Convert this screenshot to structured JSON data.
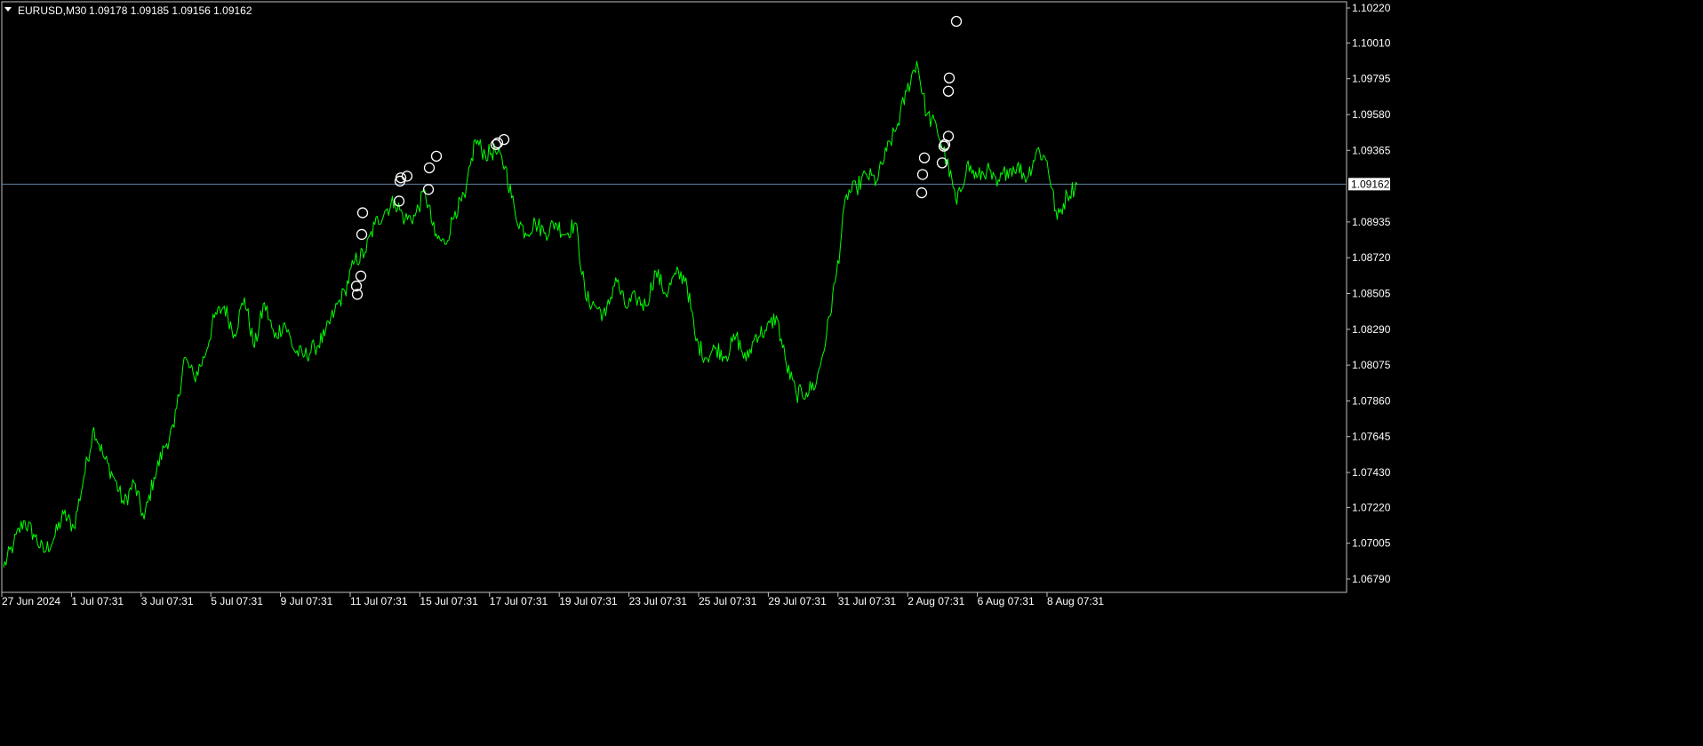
{
  "header": {
    "symbol": "EURUSD,M30",
    "ohlc": "1.09178 1.09185 1.09156 1.09162",
    "dropdown_icon": "triangle-down-icon"
  },
  "colors": {
    "background": "#000000",
    "frame": "#c0c0c0",
    "price_line": "#00ff00",
    "marker": "#ffffff",
    "current_price_line": "#5f7f9f",
    "price_tag_bg": "#ffffff",
    "price_tag_text": "#000000",
    "text": "#ffffff"
  },
  "chart_data": {
    "type": "line",
    "symbol": "EURUSD",
    "timeframe": "M30",
    "y_ticks": [
      "1.10220",
      "1.10010",
      "1.09795",
      "1.09580",
      "1.09365",
      "1.08935",
      "1.08720",
      "1.08505",
      "1.08290",
      "1.08075",
      "1.07860",
      "1.07645",
      "1.07430",
      "1.07220",
      "1.07005",
      "1.06790"
    ],
    "ylim": [
      1.0674,
      1.1022
    ],
    "x_ticks": [
      "27 Jun 2024",
      "1 Jul 07:31",
      "3 Jul 07:31",
      "5 Jul 07:31",
      "9 Jul 07:31",
      "11 Jul 07:31",
      "15 Jul 07:31",
      "17 Jul 07:31",
      "19 Jul 07:31",
      "23 Jul 07:31",
      "25 Jul 07:31",
      "29 Jul 07:31",
      "31 Jul 07:31",
      "2 Aug 07:31",
      "6 Aug 07:31",
      "8 Aug 07:31"
    ],
    "current_price": "1.09162",
    "series": [
      {
        "values": [
          1.0686,
          1.07,
          1.0714,
          1.0706,
          1.0695,
          1.0703,
          1.0718,
          1.071,
          1.074,
          1.077,
          1.0752,
          1.074,
          1.0724,
          1.0737,
          1.0715,
          1.074,
          1.0758,
          1.077,
          1.0812,
          1.08,
          1.0812,
          1.0836,
          1.0843,
          1.0826,
          1.0848,
          1.0818,
          1.0845,
          1.0824,
          1.0833,
          1.0816,
          1.0813,
          1.0818,
          1.0825,
          1.084,
          1.0852,
          1.087,
          1.0875,
          1.0892,
          1.09,
          1.0906,
          1.0895,
          1.0897,
          1.0912,
          1.0885,
          1.088,
          1.09,
          1.0908,
          1.0943,
          1.0934,
          1.0936,
          1.0927,
          1.0898,
          1.0887,
          1.0893,
          1.0887,
          1.0893,
          1.0886,
          1.0893,
          1.0848,
          1.0843,
          1.0837,
          1.086,
          1.0842,
          1.0848,
          1.0843,
          1.0864,
          1.085,
          1.0862,
          1.086,
          1.0822,
          1.0812,
          1.0818,
          1.0813,
          1.0825,
          1.081,
          1.0826,
          1.0828,
          1.0837,
          1.0808,
          1.079,
          1.0791,
          1.0797,
          1.0825,
          1.0862,
          1.091,
          1.0914,
          1.0922,
          1.0918,
          1.0936,
          1.095,
          1.0972,
          1.099,
          1.0958,
          1.095,
          1.093,
          1.0904,
          1.0928,
          1.092,
          1.0925,
          1.0915,
          1.0925,
          1.0927,
          1.092,
          1.0937,
          1.093,
          1.0895,
          1.091,
          1.0916
        ]
      }
    ],
    "marker_prices": [
      1.085,
      1.0855,
      1.0861,
      1.0886,
      1.0899,
      1.0906,
      1.0918,
      1.092,
      1.0921,
      1.0913,
      1.0926,
      1.0933,
      1.094,
      1.0941,
      1.0943,
      1.0911,
      1.0922,
      1.0932,
      1.0929,
      1.0939,
      1.094,
      1.0945,
      1.0972,
      1.098,
      1.1014
    ]
  }
}
